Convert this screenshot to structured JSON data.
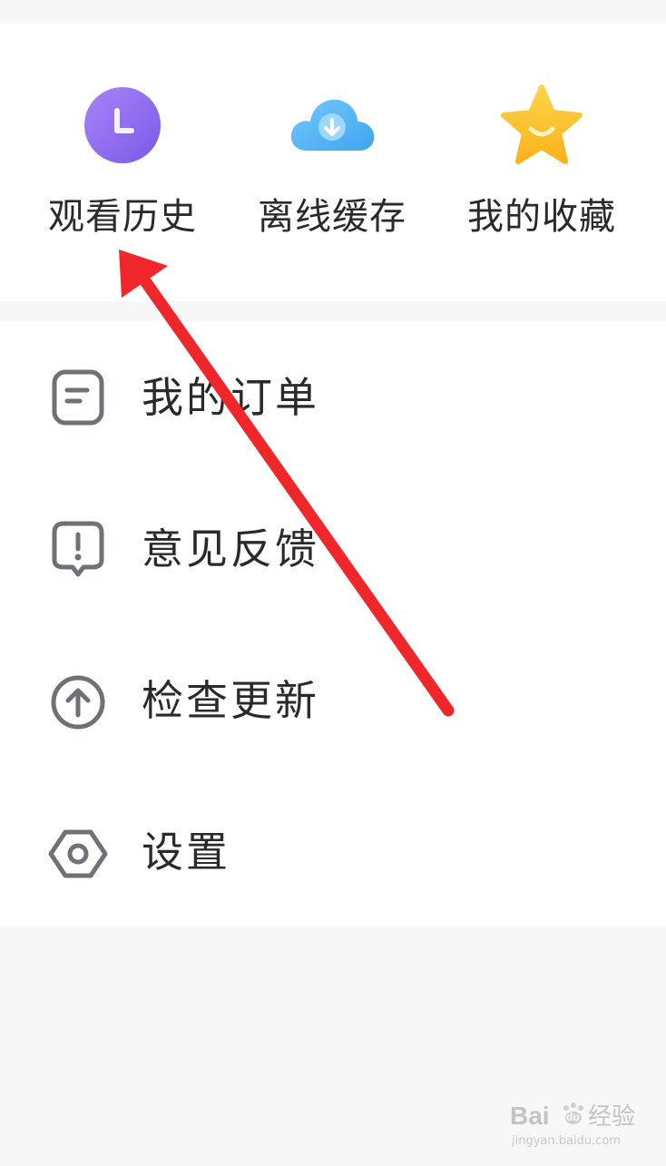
{
  "quick_actions": {
    "history": {
      "label": "观看历史",
      "icon": "clock-icon",
      "color": "#8c6cf0"
    },
    "offline": {
      "label": "离线缓存",
      "icon": "cloud-download-icon",
      "color": "#58b6f4"
    },
    "favorites": {
      "label": "我的收藏",
      "icon": "star-icon",
      "color": "#fcc12c"
    }
  },
  "menu": {
    "items": [
      {
        "label": "我的订单",
        "icon": "order-list-icon"
      },
      {
        "label": "意见反馈",
        "icon": "feedback-icon"
      },
      {
        "label": "检查更新",
        "icon": "upload-arrow-icon"
      },
      {
        "label": "设置",
        "icon": "hexagon-settings-icon"
      }
    ]
  },
  "annotation": {
    "color": "#f0272a",
    "icon": "red-arrow-icon"
  },
  "watermark": {
    "brand": "Bai",
    "brand_mid": "du",
    "suffix": "经验",
    "url": "jingyan.baidu.com"
  }
}
